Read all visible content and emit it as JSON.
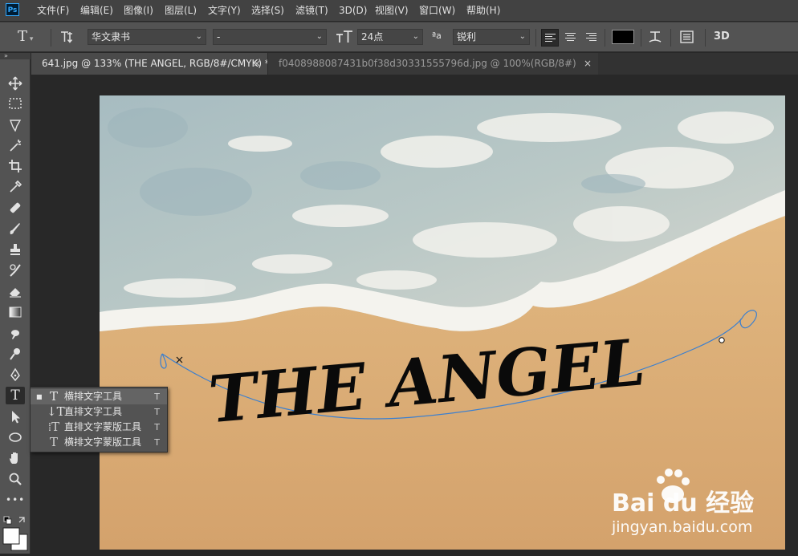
{
  "app": {
    "logo": "Ps"
  },
  "menu": {
    "items": [
      "文件(F)",
      "编辑(E)",
      "图像(I)",
      "图层(L)",
      "文字(Y)",
      "选择(S)",
      "滤镜(T)",
      "3D(D)",
      "视图(V)",
      "窗口(W)",
      "帮助(H)"
    ]
  },
  "options": {
    "tool_glyph": "T",
    "font_family": "华文隶书",
    "font_style": "-",
    "font_size": "24点",
    "aa_glyph": "ªa",
    "antialias": "锐利",
    "text_color": "#000000",
    "threed_label": "3D"
  },
  "tabs": [
    {
      "label": "641.jpg @ 133% (THE ANGEL, RGB/8#/CMYK) *",
      "close": "×"
    },
    {
      "label": "f0408988087431b0f38d30331555796d.jpg @ 100%(RGB/8#)",
      "close": "×"
    }
  ],
  "toolbar": {
    "grip": "»",
    "more": "•••"
  },
  "flyout": {
    "items": [
      {
        "label": "横排文字工具",
        "shortcut": "T",
        "icon": "horizontal-type-icon",
        "selected": true
      },
      {
        "label": "直排文字工具",
        "shortcut": "T",
        "icon": "vertical-type-icon",
        "selected": false
      },
      {
        "label": "直排文字蒙版工具",
        "shortcut": "T",
        "icon": "vertical-type-mask-icon",
        "selected": false
      },
      {
        "label": "横排文字蒙版工具",
        "shortcut": "T",
        "icon": "horizontal-type-mask-icon",
        "selected": false
      }
    ]
  },
  "canvas": {
    "text": "THE ANGEL",
    "watermark_brand": "Bai du 经验",
    "watermark_url": "jingyan.baidu.com"
  },
  "colors": {
    "foreground": "#ffffff",
    "background": "#ffffff",
    "path": "#3a7fd0"
  }
}
